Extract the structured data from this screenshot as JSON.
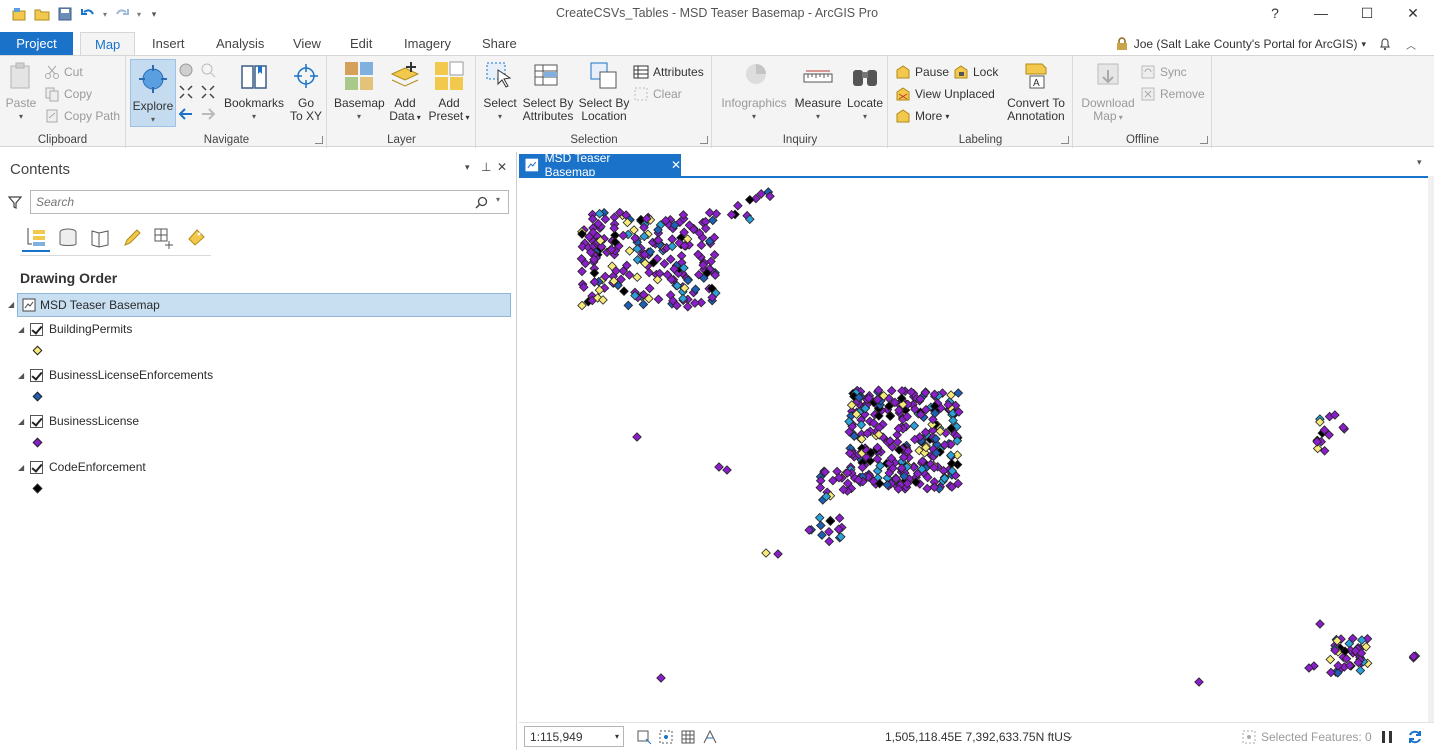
{
  "window": {
    "title": "CreateCSVs_Tables - MSD Teaser Basemap - ArcGIS Pro",
    "help": "?",
    "minimize": "—",
    "maximize": "☐",
    "close": "✕"
  },
  "tabs": {
    "project": "Project",
    "map": "Map",
    "insert": "Insert",
    "analysis": "Analysis",
    "view": "View",
    "edit": "Edit",
    "imagery": "Imagery",
    "share": "Share"
  },
  "user": {
    "name": "Joe (Salt Lake County's Portal for ArcGIS)",
    "dropdown": "▾"
  },
  "ribbon": {
    "clipboard": {
      "label": "Clipboard",
      "paste": "Paste",
      "cut": "Cut",
      "copy": "Copy",
      "copy_path": "Copy Path"
    },
    "navigate": {
      "label": "Navigate",
      "explore": "Explore",
      "bookmarks": "Bookmarks",
      "go_to_xy_1": "Go",
      "go_to_xy_2": "To XY"
    },
    "layer": {
      "label": "Layer",
      "basemap": "Basemap",
      "add_data_1": "Add",
      "add_data_2": "Data",
      "add_preset_1": "Add",
      "add_preset_2": "Preset"
    },
    "selection": {
      "label": "Selection",
      "select": "Select",
      "sba_1": "Select By",
      "sba_2": "Attributes",
      "sbl_1": "Select By",
      "sbl_2": "Location",
      "attributes": "Attributes",
      "clear": "Clear"
    },
    "inquiry": {
      "label": "Inquiry",
      "infographics": "Infographics",
      "measure": "Measure",
      "locate": "Locate"
    },
    "labeling": {
      "label": "Labeling",
      "pause": "Pause",
      "lock": "Lock",
      "view_unplaced": "View Unplaced",
      "more": "More",
      "convert_1": "Convert To",
      "convert_2": "Annotation"
    },
    "offline": {
      "label": "Offline",
      "download_1": "Download",
      "download_2": "Map",
      "sync": "Sync",
      "remove": "Remove"
    }
  },
  "contents": {
    "title": "Contents",
    "search_placeholder": "Search",
    "drawing_order": "Drawing Order",
    "map_name": "MSD Teaser Basemap",
    "layers": [
      {
        "name": "BuildingPermits",
        "symbol_color": "#f5e97a"
      },
      {
        "name": "BusinessLicenseEnforcements",
        "symbol_color": "#1f5fb3"
      },
      {
        "name": "BusinessLicense",
        "symbol_color": "#8a1fc9"
      },
      {
        "name": "CodeEnforcement",
        "symbol_color": "#000000"
      }
    ]
  },
  "map": {
    "tab_title": "MSD Teaser Basemap",
    "scale": "1:115,949",
    "coordinates": "1,505,118.45E 7,392,633.75N ftUS",
    "selected_features": "Selected Features: 0"
  },
  "colors": {
    "accent": "#1a73c8",
    "purple": "#8a1fc9",
    "yellow": "#f5e97a",
    "blue": "#1f5fb3",
    "cyan": "#2aa0d6",
    "black": "#000000"
  }
}
